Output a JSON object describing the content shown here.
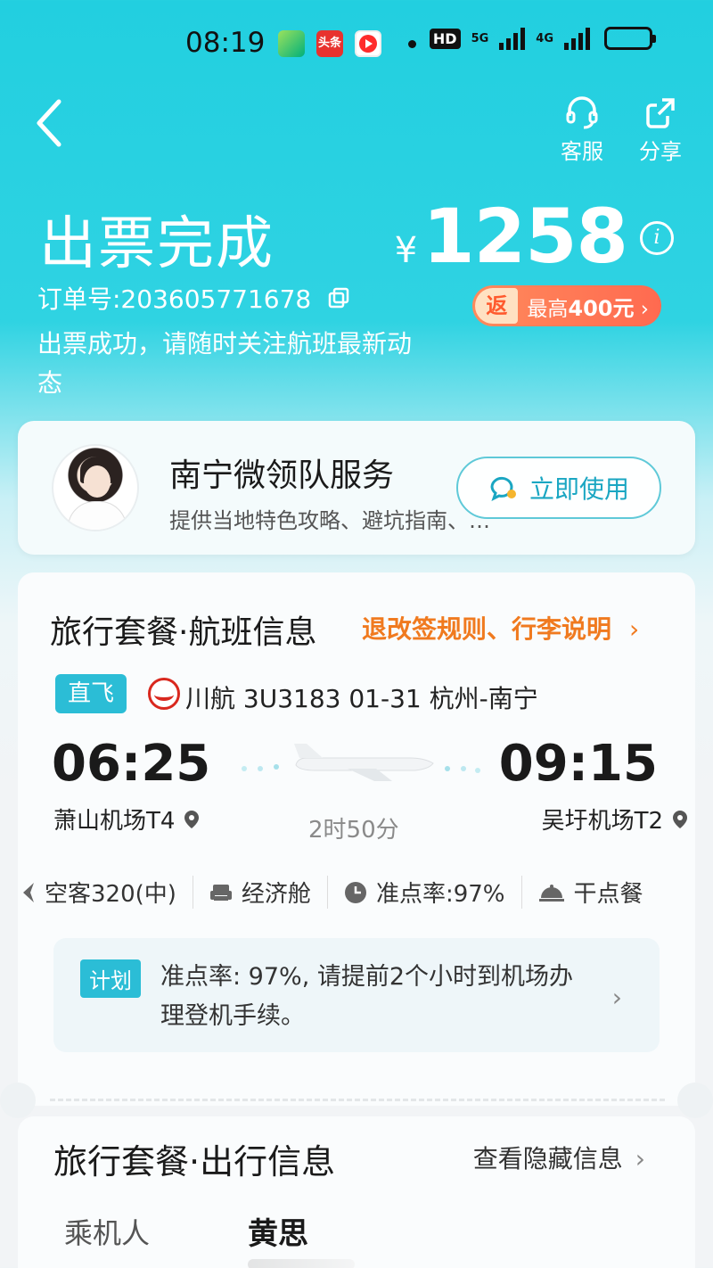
{
  "status_bar": {
    "time": "08:19",
    "hd": "HD",
    "net1": "5G",
    "net2": "4G",
    "apps": [
      "app-green-icon",
      "toutiao-icon",
      "video-icon"
    ],
    "app_label_toutiao": "头条"
  },
  "header": {
    "service_label": "客服",
    "share_label": "分享",
    "title": "出票完成",
    "order_no": "订单号:203605771678",
    "tip": "出票成功，请随时关注航班最新动态",
    "currency": "¥",
    "price": "1258",
    "rebate_tag": "返",
    "rebate_text": "最高",
    "rebate_amount": "400元",
    "rebate_chevron": "›"
  },
  "service_card": {
    "name": "南宁微领队服务",
    "desc": "提供当地特色攻略、避坑指南、…",
    "button": "立即使用"
  },
  "flight_card": {
    "title": "旅行套餐·航班信息",
    "rules_link": "退改签规则、行李说明",
    "chevron": "›",
    "direct_tag": "直飞",
    "flight_info": "川航 3U3183   01-31 杭州-南宁",
    "dep_time": "06:25",
    "arr_time": "09:15",
    "dep_airport": "萧山机场T4",
    "arr_airport": "吴圩机场T2",
    "duration": "2时50分",
    "attrs": [
      {
        "icon": "plane-icon",
        "label": "空客320(中)"
      },
      {
        "icon": "seat-icon",
        "label": "经济舱"
      },
      {
        "icon": "clock-icon",
        "label": "准点率:97%"
      },
      {
        "icon": "meal-icon",
        "label": "干点餐"
      }
    ],
    "plan_badge": "计划",
    "plan_text": "准点率: 97%, 请提前2个小时到机场办理登机手续。"
  },
  "travel_card": {
    "title": "旅行套餐·出行信息",
    "hidden_link": "查看隐藏信息",
    "passenger_label": "乘机人",
    "passenger_name": "黄思"
  },
  "colors": {
    "header_bg": "#22cfe0",
    "accent": "#2bbdd6",
    "orange": "#f07a1f",
    "rebate": "#ff6a50"
  }
}
